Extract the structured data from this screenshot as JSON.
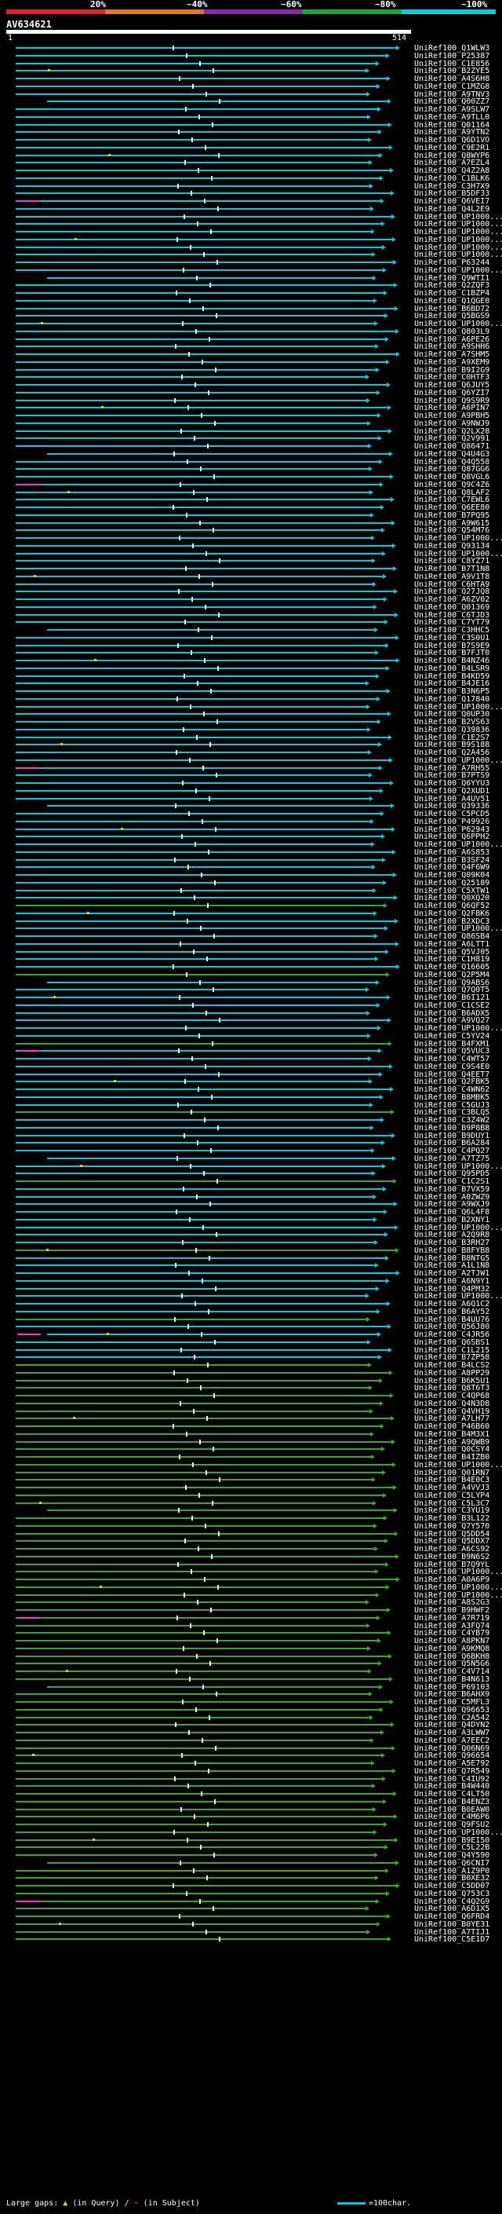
{
  "scale": {
    "labels": [
      "20%",
      "~40%",
      "~60%",
      "~80%",
      "~100%"
    ],
    "colors": [
      "#e0202a",
      "#e07a1a",
      "#8a2aa8",
      "#1aa83a",
      "#00ccdd"
    ]
  },
  "query": {
    "id": "AV634621",
    "start": "1",
    "end": "514"
  },
  "colors": {
    "high": "#00ccdd",
    "mid": "#33aa22",
    "gap_query": "#ffcc00",
    "gap_subject": "#ff33cc",
    "marker": "#ffffff"
  },
  "hits": [
    "UniRef100_Q1WLW3",
    "UniRef100_P25387",
    "UniRef100_C1E856",
    "UniRef100_B2ZYE5",
    "UniRef100_A4S6H8",
    "UniRef100_C1MZG8",
    "UniRef100_A9TNV3",
    "UniRef100_Q00ZZ7",
    "UniRef100_A9SLW7",
    "UniRef100_A9TLL0",
    "UniRef100_Q01164",
    "UniRef100_A9YTN2",
    "UniRef100_Q6D1VO",
    "UniRef100_C9E2R1",
    "UniRef100_Q8WYP6",
    "UniRef100_A7EZL4",
    "UniRef100_Q4Z2A8",
    "UniRef100_C1BLK6",
    "UniRef100_C3H7X9",
    "UniRef100_B5DF33",
    "UniRef100_Q6VEI7",
    "UniRef100_Q4L2E9",
    "UniRef100_UP1000...",
    "UniRef100_UP1000...",
    "UniRef100_UP1000...",
    "UniRef100_UP1000...",
    "UniRef100_UP1000...",
    "UniRef100_UP1000...",
    "UniRef100_P63244",
    "UniRef100_UP1000...",
    "UniRef100_Q9WTI1",
    "UniRef100_Q2ZQF3",
    "UniRef100_C1BZP4",
    "UniRef100_Q1QGE0",
    "UniRef100_B6BD72",
    "UniRef100_Q5BGS9",
    "UniRef100_UP1000...",
    "UniRef100_Q803L9",
    "UniRef100_A6PE26",
    "UniRef100_A9SHH6",
    "UniRef100_A7SHM5",
    "UniRef100_A9XEM9",
    "UniRef100_B9I2G9",
    "UniRef100_C0HTF3",
    "UniRef100_Q6JUY5",
    "UniRef100_Q6YZI7",
    "UniRef100_Q9S9R9",
    "UniRef100_A6PIN7",
    "UniRef100_A9PBH5",
    "UniRef100_A9NWJ9",
    "UniRef100_Q2LX28",
    "UniRef100_Q2V991",
    "UniRef100_Q86471",
    "UniRef100_Q4U4G3",
    "UniRef100_Q4Q558",
    "UniRef100_Q87GG6",
    "UniRef100_Q8VGL6",
    "UniRef100_Q9C4Z6",
    "UniRef100_Q8LAF2",
    "UniRef100_C7EWL6",
    "UniRef100_Q6EE80",
    "UniRef100_B7PQ95",
    "UniRef100_A9W615",
    "UniRef100_Q54M76",
    "UniRef100_UP1000...",
    "UniRef100_Q93134",
    "UniRef100_UP1000...",
    "UniRef100_C8YZ71",
    "UniRef100_B7T1N8",
    "UniRef100_A9V1T8",
    "UniRef100_C6HTA9",
    "UniRef100_Q27JQ8",
    "UniRef100_A6ZV02",
    "UniRef100_Q01369",
    "UniRef100_C6TJD3",
    "UniRef100_C7YT79",
    "UniRef100_C3HHC5",
    "UniRef100_C3S0U1",
    "UniRef100_B7S9E9",
    "UniRef100_B7FJT0",
    "UniRef100_B4NZ46",
    "UniRef100_B4LSR9",
    "UniRef100_B4KD59",
    "UniRef100_B4JE16",
    "UniRef100_B3N6P5",
    "UniRef100_Q17840",
    "UniRef100_UP1000...",
    "UniRef100_Q0UP30",
    "UniRef100_B2VS63",
    "UniRef100_Q39836",
    "UniRef100_C1E2S7",
    "UniRef100_B9S188",
    "UniRef100_Q2A456",
    "UniRef100_UP1000...",
    "UniRef100_A7RH55",
    "UniRef100_B7PTS9",
    "UniRef100_Q6YYU3",
    "UniRef100_Q2XUD1",
    "UniRef100_A4UV51",
    "UniRef100_Q39336",
    "UniRef100_C5PCD5",
    "UniRef100_P49926",
    "UniRef100_P62943",
    "UniRef100_Q6PPH2",
    "UniRef100_UP1000...",
    "UniRef100_A6S853",
    "UniRef100_B3SF24",
    "UniRef100_Q4F6W9",
    "UniRef100_Q09K04",
    "UniRef100_Q25189",
    "UniRef100_C5XTW1",
    "UniRef100_Q0XQ20",
    "UniRef100_Q6QF52",
    "UniRef100_Q2FBK6",
    "UniRef100_B2XDC3",
    "UniRef100_UP1000...",
    "UniRef100_Q86SB4",
    "UniRef100_A6LTT1",
    "UniRef100_Q5VJ05",
    "UniRef100_C1H819",
    "UniRef100_Q16605",
    "UniRef100_Q2P5M4",
    "UniRef100_Q9ABS6",
    "UniRef100_Q7Q0T5",
    "UniRef100_B6I121",
    "UniRef100_C1CSE2",
    "UniRef100_B6ADX5",
    "UniRef100_A9VQ27",
    "UniRef100_UP1000...",
    "UniRef100_C5YV24",
    "UniRef100_B4FXM1",
    "UniRef100_Q5VUC3",
    "UniRef100_C4WT57",
    "UniRef100_C9S4E0",
    "UniRef100_Q4EET7",
    "UniRef100_Q2FBK5",
    "UniRef100_C4WN62",
    "UniRef100_B8MBK5",
    "UniRef100_C5GUJ3",
    "UniRef100_C3BLQ5",
    "UniRef100_C3Z4W2",
    "UniRef100_B9P8B8",
    "UniRef100_B9DUY1",
    "UniRef100_B6A284",
    "UniRef100_C4PQ27",
    "UniRef100_A7TZ75",
    "UniRef100_UP1000...",
    "UniRef100_Q95PD5",
    "UniRef100_C1C2S1",
    "UniRef100_B7VX59",
    "UniRef100_A0ZWZ9",
    "UniRef100_A9WXJ9",
    "UniRef100_Q6L4F8",
    "UniRef100_B2XNY1",
    "UniRef100_UP1000...",
    "UniRef100_A2Q9R8",
    "UniRef100_B3RH27",
    "UniRef100_B8FYB8",
    "UniRef100_B8NTG5",
    "UniRef100_A1L1N8",
    "UniRef100_A2TJW1",
    "UniRef100_A6N9Y1",
    "UniRef100_Q4PM32",
    "UniRef100_UP1000...",
    "UniRef100_A6Q1C2",
    "UniRef100_B6AY52",
    "UniRef100_B4UU76",
    "UniRef100_Q56J80",
    "UniRef100_C4JR56",
    "UniRef100_Q6SBS1",
    "UniRef100_C1L215",
    "UniRef100_B7ZP58",
    "UniRef100_B4LCS2",
    "UniRef100_A8PP29",
    "UniRef100_B6K5U1",
    "UniRef100_Q8T6T3",
    "UniRef100_C4QP68",
    "UniRef100_Q4N3D8",
    "UniRef100_Q4VH19",
    "UniRef100_A7LH77",
    "UniRef100_P46B60",
    "UniRef100_B4M3X1",
    "UniRef100_A9QWB9",
    "UniRef100_Q0CSY4",
    "UniRef100_B4IZB0",
    "UniRef100_UP1000...",
    "UniRef100_Q01RN7",
    "UniRef100_B4E0C3",
    "UniRef100_A4VVJ3",
    "UniRef100_C5LYP4",
    "UniRef100_C5L3C7",
    "UniRef100_C3YU19",
    "UniRef100_B3L122",
    "UniRef100_Q7Y570",
    "UniRef100_Q5DD54",
    "UniRef100_Q5DDX7",
    "UniRef100_A6CS92",
    "UniRef100_B9N6S2",
    "UniRef100_B7Q9YL",
    "UniRef100_UP1000...",
    "UniRef100_A0A6P9",
    "UniRef100_UP1000...",
    "UniRef100_UP1000...",
    "UniRef100_A8S2G3",
    "UniRef100_B9HWF2",
    "UniRef100_A7R719",
    "UniRef100_A3FQ74",
    "UniRef100_C4YB79",
    "UniRef100_A8PKN7",
    "UniRef100_A9KMQ8",
    "UniRef100_Q6BKH8",
    "UniRef100_Q5N5G6",
    "UniRef100_C4V714",
    "UniRef100_B4N613",
    "UniRef100_P69103",
    "UniRef100_B6AHX9",
    "UniRef100_C5MFL3",
    "UniRef100_Q96653",
    "UniRef100_C2A542",
    "UniRef100_Q4DYN2",
    "UniRef100_A3LWW7",
    "UniRef100_A7EEC2",
    "UniRef100_Q06N69",
    "UniRef100_Q96654",
    "UniRef100_A5E792",
    "UniRef100_Q7R549",
    "UniRef100_C4IU92",
    "UniRef100_B4W440",
    "UniRef100_C4LT50",
    "UniRef100_B4ENZ3",
    "UniRef100_B0EAW0",
    "UniRef100_C4M6P6",
    "UniRef100_Q9FSU2",
    "UniRef100_UP1000...",
    "UniRef100_B9EI50",
    "UniRef100_C5L22B",
    "UniRef100_Q4Y590",
    "UniRef100_Q6CNI7",
    "UniRef100_A1Z9P0",
    "UniRef100_B0XE32",
    "UniRef100_C5DD07",
    "UniRef100_Q753C3",
    "UniRef100_C4Q2G9",
    "UniRef100_A6D1X5",
    "UniRef100_Q6FRD4",
    "UniRef100_B0YE31",
    "UniRef100_A7TIJ1",
    "UniRef100_C5E1D7"
  ],
  "legend": {
    "prefix": "Large gaps:",
    "query_gap": "(in Query)",
    "subject_gap": "(in Subject)",
    "key": "=100char."
  }
}
